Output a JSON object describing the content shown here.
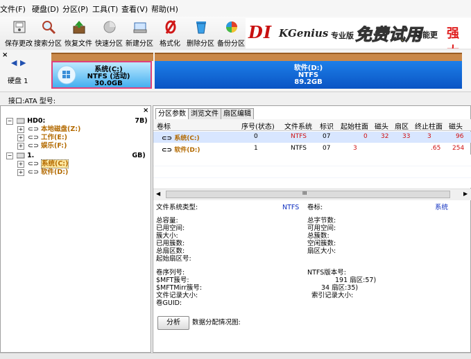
{
  "menu": {
    "file": "文件(F)",
    "disk": "硬盘(D)",
    "partition": "分区(P)",
    "tools": "工具(T)",
    "view": "查看(V)",
    "help": "帮助(H)"
  },
  "toolbar": {
    "save": "保存更改",
    "search": "搜索分区",
    "recover": "恢复文件",
    "quick": "快速分区",
    "new": "新建分区",
    "format": "格式化",
    "delete": "删除分区",
    "backup": "备份分区"
  },
  "banner": {
    "logo_a": "DI",
    "logo_b": "KGenius",
    "edition": "专业版",
    "free": "免费试用",
    "func": "功能更",
    "strong": "强大"
  },
  "diskmap": {
    "disk_label": "硬盘 1",
    "interface": "接口:ATA  型号:",
    "c_name": "系统(C:)",
    "c_fs": "NTFS (活动)",
    "c_size": "30.0GB",
    "d_name": "软件(D:)",
    "d_fs": "NTFS",
    "d_size": "89.2GB"
  },
  "tree": {
    "hd0": "HD0:",
    "hd0_size": "7B)",
    "local": "本地磁盘(Z:)",
    "work": "工作(E:)",
    "fun": "娱乐(F:)",
    "hd1": "1.",
    "hd1_size": "GB)",
    "sys": "系统(C:)",
    "soft": "软件(D:)"
  },
  "tabs": {
    "params": "分区参数",
    "browse": "浏览文件",
    "sector": "扇区编辑"
  },
  "table": {
    "headers": [
      "卷标",
      "序号(状态)",
      "文件系统",
      "标识",
      "起始柱面",
      "磁头",
      "扇区",
      "终止柱面",
      "磁头"
    ],
    "rows": [
      [
        "系统(C:)",
        "0",
        "NTFS",
        "07",
        "0",
        "32",
        "33",
        "3",
        "96"
      ],
      [
        "软件(D:)",
        "1",
        "NTFS",
        "07",
        "3",
        "",
        "",
        ".65",
        "254"
      ]
    ]
  },
  "info": {
    "fs_type_label": "文件系统类型:",
    "fs_type_value": "NTFS",
    "vol_label": "卷标:",
    "vol_value": "系统",
    "capacity": "总容量:",
    "used": "已用空间:",
    "cluster_size": "簇大小:",
    "used_clusters": "已用簇数:",
    "total_sectors": "总扇区数:",
    "start_sector": "起始扇区号:",
    "total_bytes": "总字节数:",
    "free_space": "可用空间:",
    "total_clusters": "总簇数:",
    "free_clusters": "空闲簇数:",
    "sector_size": "扇区大小:",
    "volume_serial": "卷序列号:",
    "mft_cluster": "$MFT簇号:",
    "mftmirr_cluster": "$MFTMirr簇号:",
    "file_record_size": "文件记录大小:",
    "volume_guid": "卷GUID:",
    "ntfs_version": "NTFS版本号:",
    "mft_fragment": "191 扇区:57)",
    "mftmirr_fragment": "34 扇区:35)",
    "index_size": "索引记录大小:",
    "analyze": "分析",
    "distribution": "数据分配情况图:",
    "scroll_mark": "III"
  }
}
